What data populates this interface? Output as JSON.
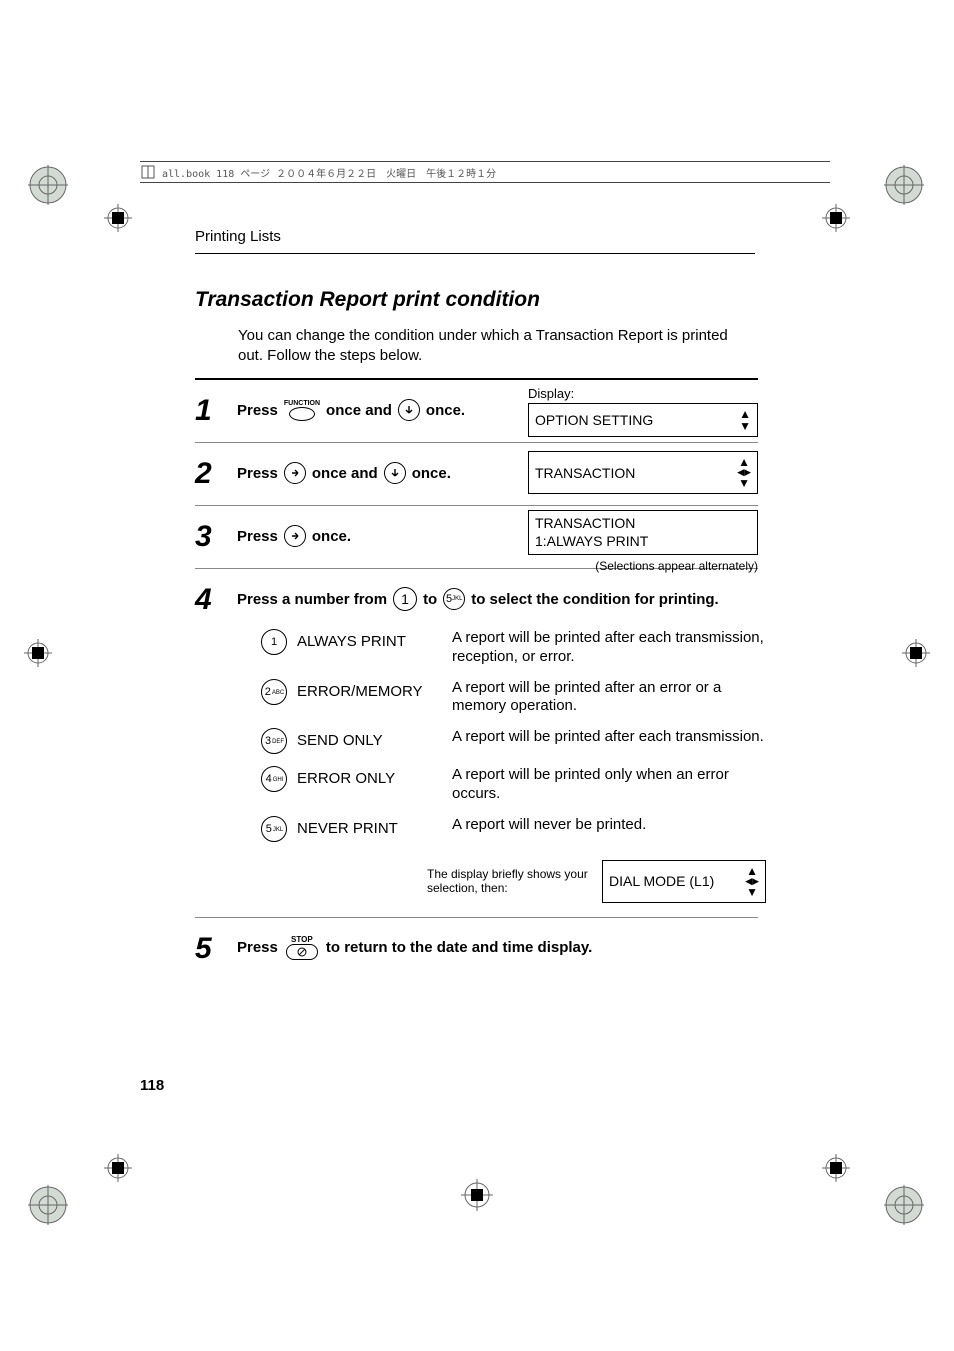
{
  "header": {
    "text": "all.book  118 ページ  ２００４年６月２２日　火曜日　午後１２時１分"
  },
  "section_title": "Printing Lists",
  "heading": "Transaction Report print condition",
  "intro": "You can change the condition under which a Transaction Report is printed out. Follow the steps below.",
  "steps": {
    "s1": {
      "num": "1",
      "press": "Press",
      "func_label": "FUNCTION",
      "once_and": "once and",
      "once": "once.",
      "disp_lbl": "Display:",
      "disp_val": "OPTION SETTING"
    },
    "s2": {
      "num": "2",
      "press": "Press",
      "once_and": "once and",
      "once": "once.",
      "disp_val": "TRANSACTION"
    },
    "s3": {
      "num": "3",
      "press": "Press",
      "once": "once.",
      "disp_val": "TRANSACTION\n1:ALWAYS PRINT",
      "note": "(Selections appear alternately)"
    },
    "s4": {
      "num": "4",
      "press_from": "Press a number from",
      "to": "to",
      "select_tail": "to select the condition for printing.",
      "options": [
        {
          "key": "1",
          "sub": "",
          "name": "ALWAYS PRINT",
          "desc": "A report will be printed after each transmission, reception, or error."
        },
        {
          "key": "2",
          "sub": "ABC",
          "name": "ERROR/MEMORY",
          "desc": "A report will be printed after an error or a memory operation."
        },
        {
          "key": "3",
          "sub": "DEF",
          "name": "SEND ONLY",
          "desc": "A report will be printed after each transmission."
        },
        {
          "key": "4",
          "sub": "GHI",
          "name": "ERROR ONLY",
          "desc": "A report will be printed only when an error occurs."
        },
        {
          "key": "5",
          "sub": "JKL",
          "name": "NEVER PRINT",
          "desc": "A report will never be printed."
        }
      ],
      "brief": "The display briefly shows your selection, then:",
      "brief_disp": "DIAL MODE (L1)"
    },
    "s5": {
      "num": "5",
      "press": "Press",
      "stop_label": "STOP",
      "tail": "to return to the date and time display."
    }
  },
  "page_number": "118"
}
